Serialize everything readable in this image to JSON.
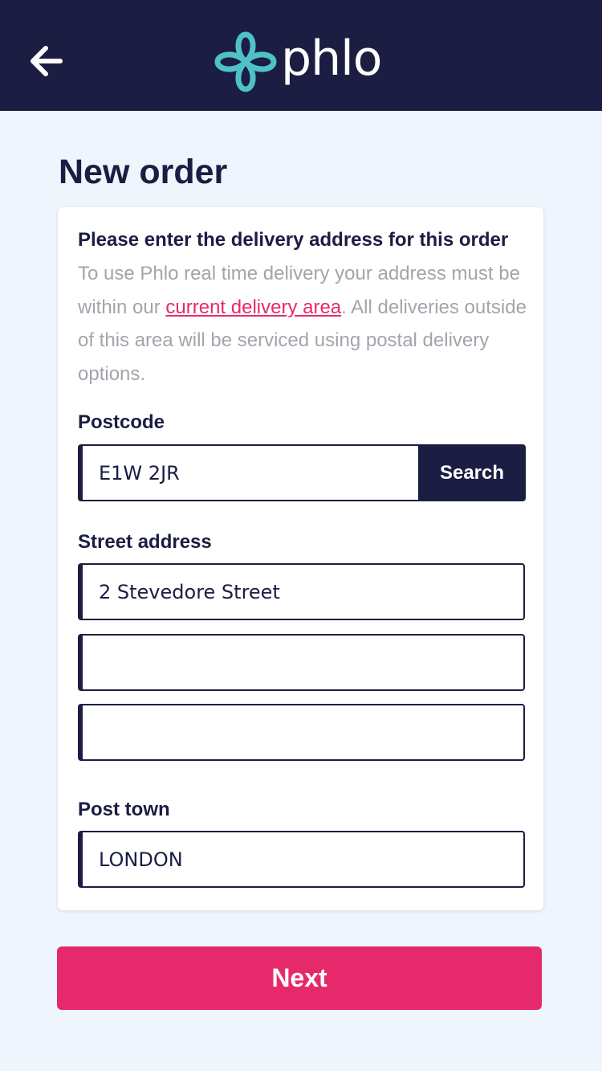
{
  "header": {
    "back_icon": "arrow-left-icon",
    "logo_icon": "phlo-cross-icon",
    "logo_text": "phlo",
    "background_color": "#1b1d42",
    "logo_color": "#4fc1c9"
  },
  "page": {
    "title": "New order"
  },
  "form": {
    "intro_title": "Please enter the delivery address for this order",
    "intro_text_before": "To use Phlo real time delivery your address must be within our ",
    "intro_link": "current delivery area",
    "intro_text_after": ". All deliveries outside of this area will be serviced using postal delivery options.",
    "postcode_label": "Postcode",
    "postcode_value": "E1W 2JR",
    "search_label": "Search",
    "street_label": "Street address",
    "street_line1": "2 Stevedore Street",
    "street_line2": "",
    "street_line3": "",
    "town_label": "Post town",
    "town_value": "LONDON"
  },
  "footer": {
    "next_label": "Next",
    "accent_color": "#e6296a"
  }
}
